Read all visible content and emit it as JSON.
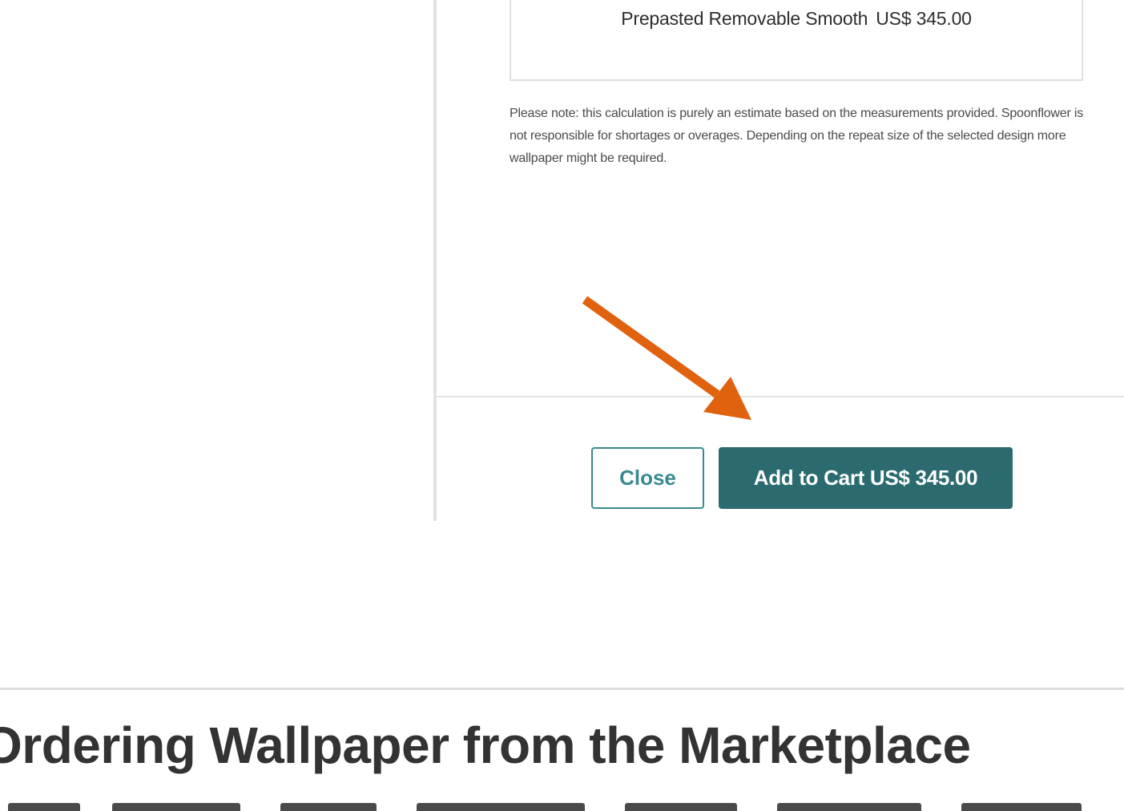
{
  "modal": {
    "product_name": "Prepasted Removable Smooth",
    "product_price": "US$ 345.00",
    "disclaimer": "Please note: this calculation is purely an estimate based on the measurements provided. Spoonflower is not responsible for shortages or overages. Depending on the repeat size of the selected design more wallpaper might be required.",
    "close_label": "Close",
    "add_to_cart_label": "Add to Cart US$ 345.00"
  },
  "annotation": {
    "arrow_color": "#e0620f"
  },
  "article": {
    "section_heading": "Ordering Wallpaper from the Marketplace"
  },
  "colors": {
    "accent": "#2b6b70",
    "outline": "#3a8a8d",
    "text": "#333333"
  }
}
